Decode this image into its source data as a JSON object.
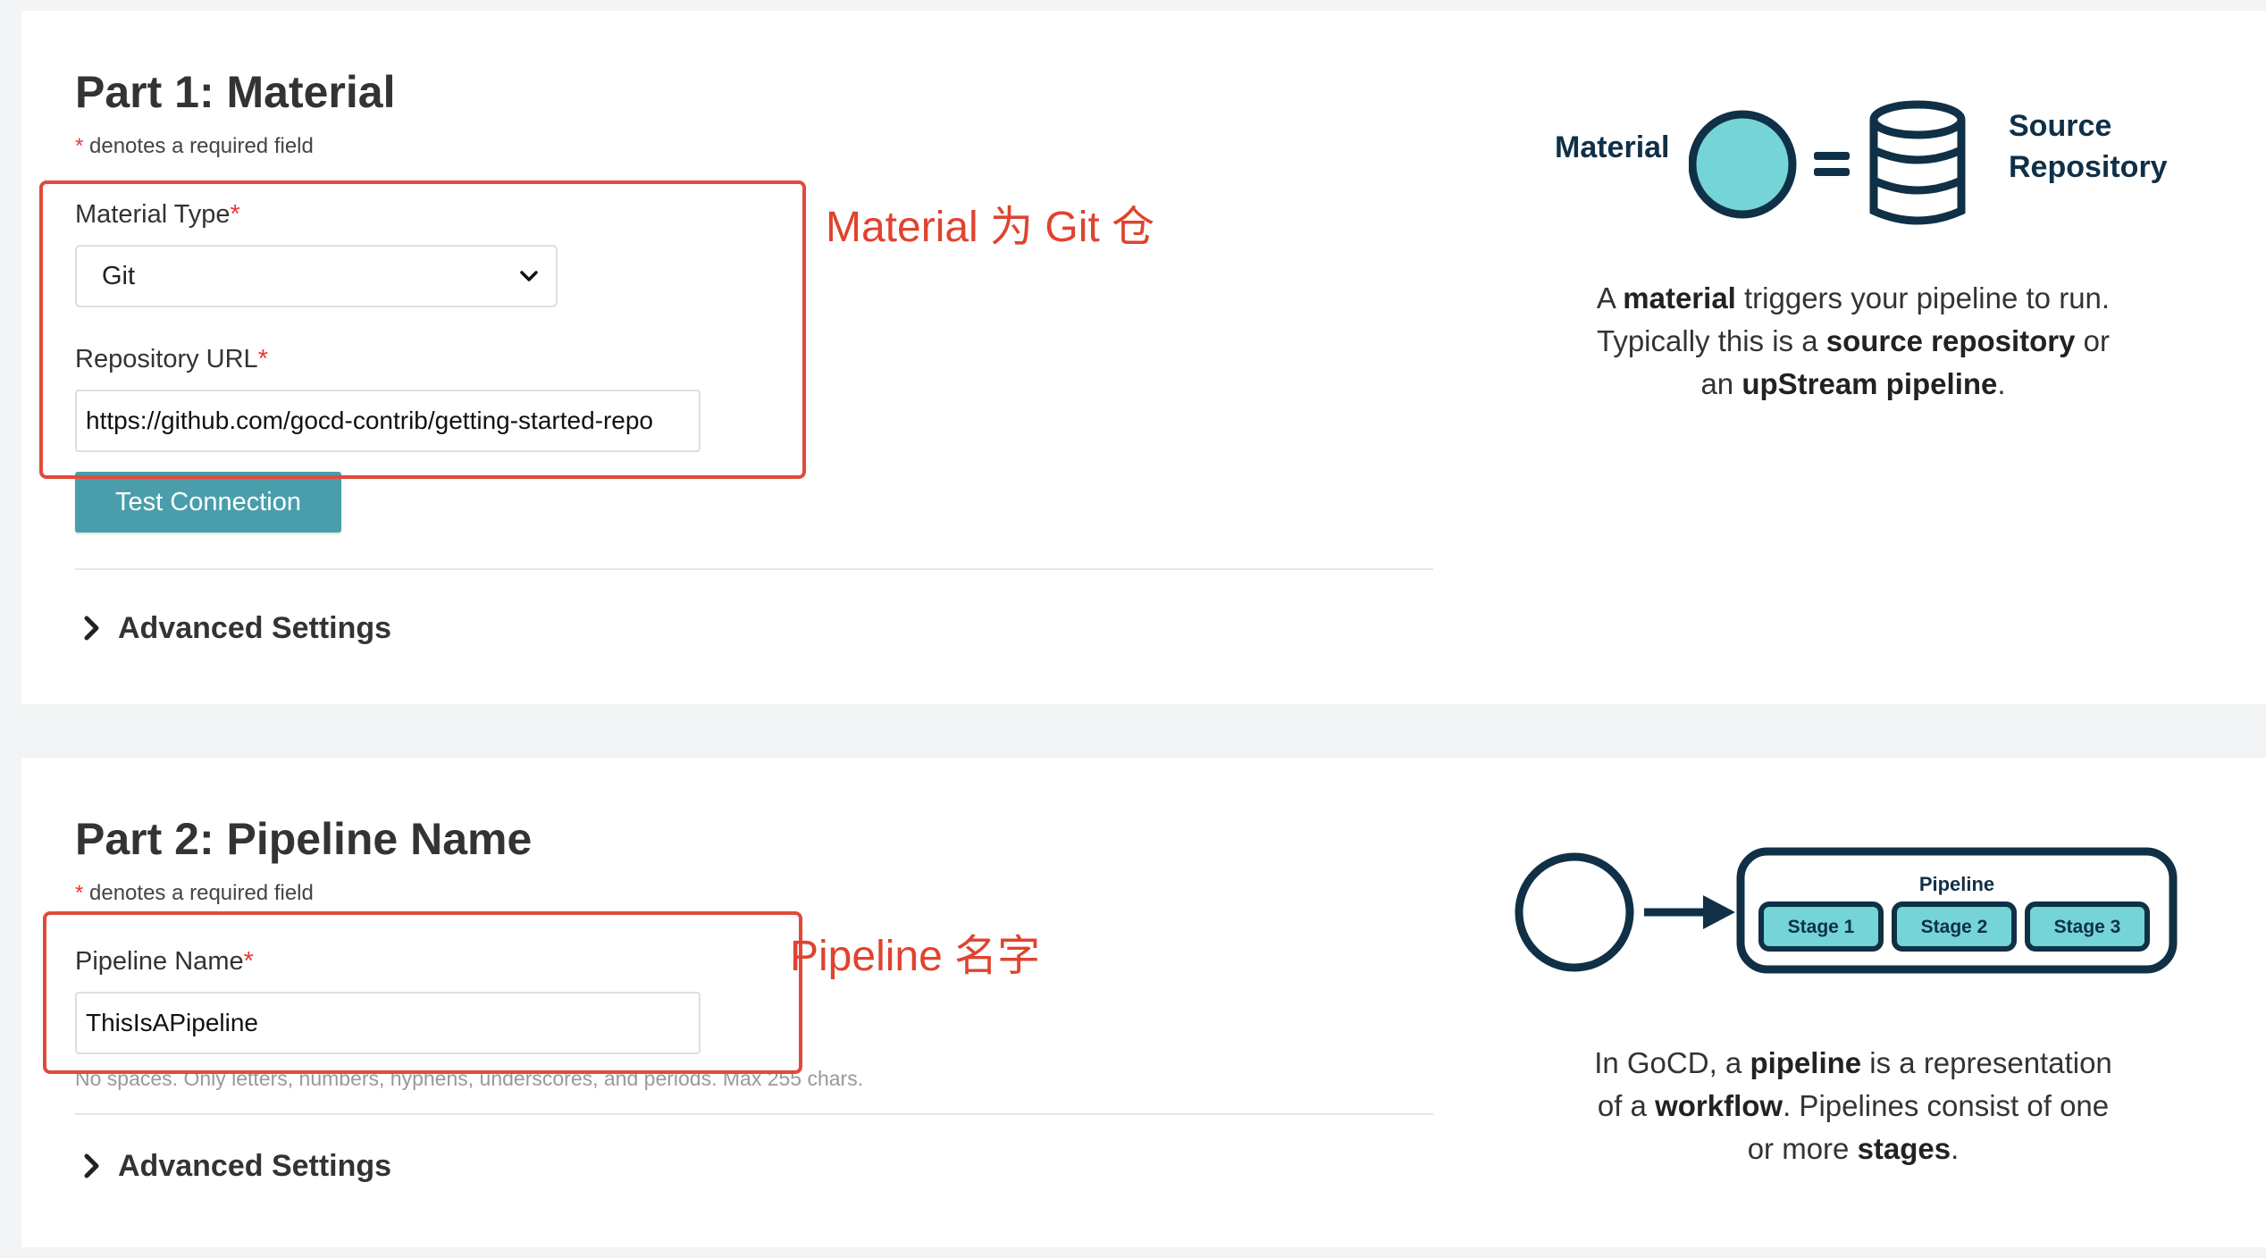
{
  "part1": {
    "title": "Part 1: Material",
    "required_note_star": "*",
    "required_note_text": " denotes a required field",
    "material_type_label": "Material Type",
    "required_star": "*",
    "material_type_value": "Git",
    "repo_url_label": "Repository URL",
    "repo_url_value": "https://github.com/gocd-contrib/getting-started-repo",
    "test_connection_label": "Test Connection",
    "advanced_settings_label": "Advanced Settings",
    "annotation": "Material 为 Git 仓",
    "illustration": {
      "material_label": "Material",
      "equals": "=",
      "source_label_line1": "Source",
      "source_label_line2": "Repository"
    },
    "description": {
      "l1_pre": "A ",
      "l1_bold": "material",
      "l1_post": " triggers your pipeline to run.",
      "l2_pre": "Typically this is a ",
      "l2_bold": "source repository",
      "l2_post": " or",
      "l3_pre": "an ",
      "l3_bold": "upStream pipeline",
      "l3_post": "."
    }
  },
  "part2": {
    "title": "Part 2: Pipeline Name",
    "required_note_star": "*",
    "required_note_text": " denotes a required field",
    "pipeline_name_label": "Pipeline Name",
    "required_star": "*",
    "pipeline_name_value": "ThisIsAPipeline",
    "hint": "No spaces. Only letters, numbers, hyphens, underscores, and periods. Max 255 chars.",
    "advanced_settings_label": "Advanced Settings",
    "annotation": "Pipeline 名字",
    "illustration": {
      "pipeline_label": "Pipeline",
      "stages": [
        "Stage 1",
        "Stage 2",
        "Stage 3"
      ]
    },
    "description": {
      "l1_pre": "In GoCD, a ",
      "l1_bold": "pipeline",
      "l1_post": " is a representation",
      "l2_pre": "of a ",
      "l2_bold": "workflow",
      "l2_post": ". Pipelines consist of one",
      "l3_pre": "or more ",
      "l3_bold": "stages",
      "l3_post": "."
    }
  },
  "colors": {
    "accent_button": "#4a9eab",
    "illustration_dark": "#0f3047",
    "illustration_fill": "#74d4d6",
    "annotation_red": "#e14a3a",
    "required_star": "#e63939"
  }
}
